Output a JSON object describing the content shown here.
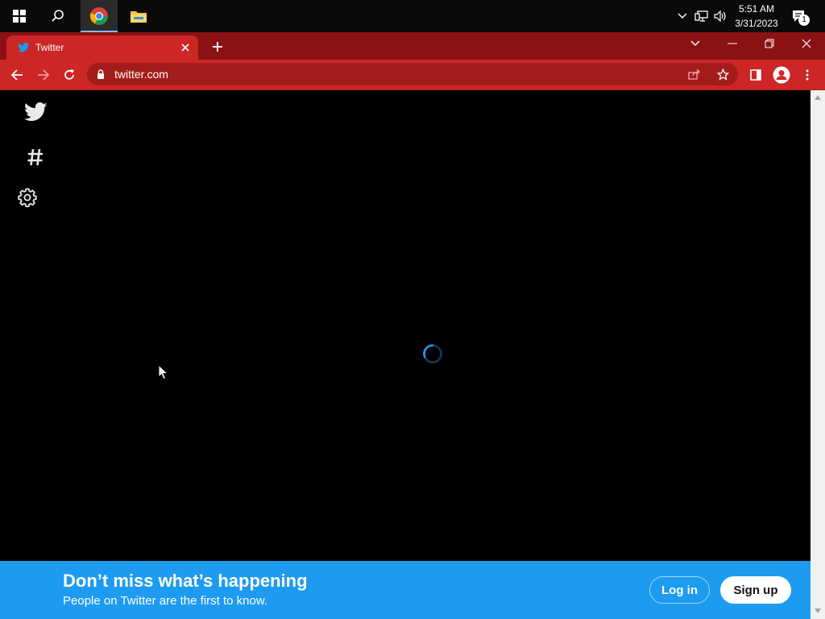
{
  "taskbar": {
    "clock_time": "5:51 AM",
    "clock_date": "3/31/2023",
    "notification_count": "1"
  },
  "browser": {
    "tab_title": "Twitter",
    "url": "twitter.com"
  },
  "sidebar": {
    "icons": [
      "twitter-logo-icon",
      "hashtag-explore-icon",
      "settings-gear-icon"
    ]
  },
  "banner": {
    "title": "Don’t miss what’s happening",
    "subtitle": "People on Twitter are the first to know.",
    "login_label": "Log in",
    "signup_label": "Sign up"
  },
  "colors": {
    "chrome_red": "#cc2626",
    "twitter_blue": "#1d9bf0"
  }
}
